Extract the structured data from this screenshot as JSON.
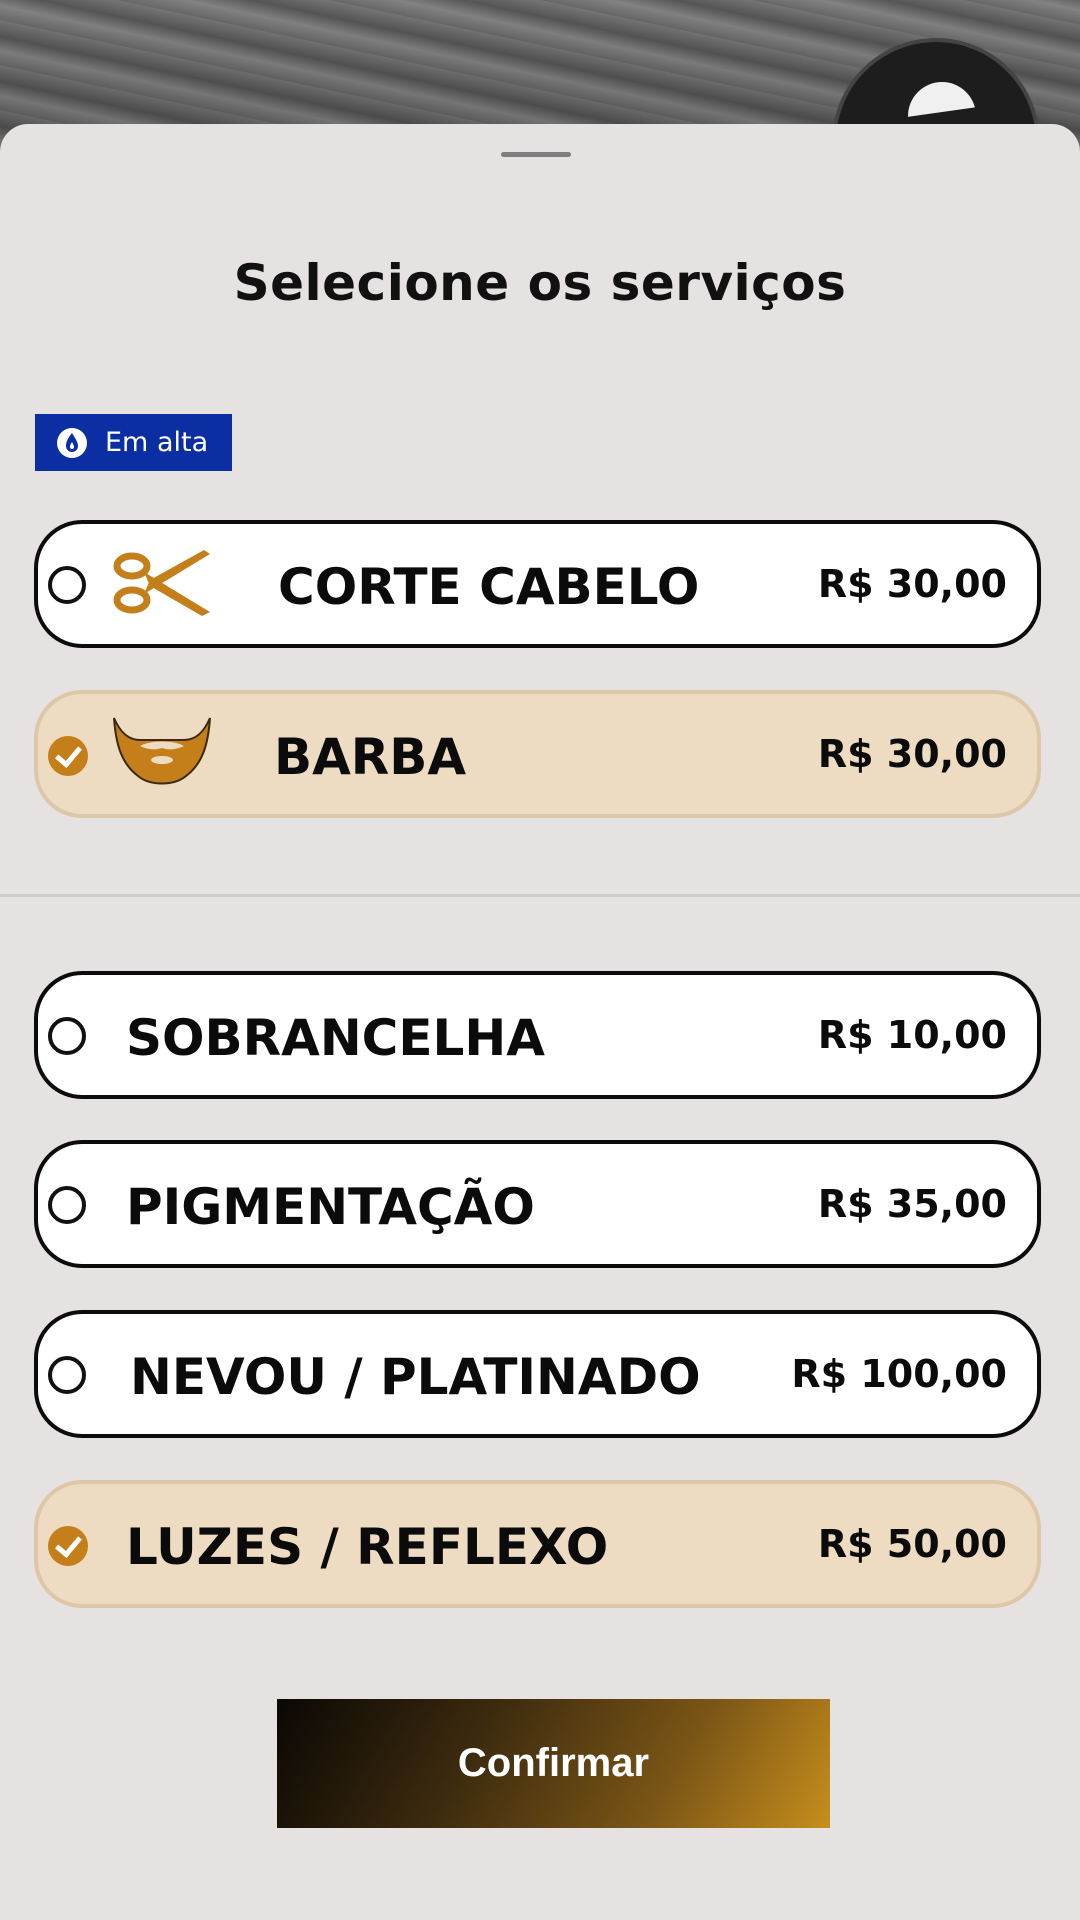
{
  "sheet": {
    "title": "Selecione os serviços",
    "badge": {
      "label": "Em alta",
      "icon": "flame-icon",
      "color": "#0b2ea3"
    }
  },
  "services": [
    {
      "name": "CORTE CABELO",
      "price": "R$ 30,00",
      "selected": false,
      "icon": "scissors-icon"
    },
    {
      "name": "BARBA",
      "price": "R$ 30,00",
      "selected": true,
      "icon": "beard-icon"
    },
    {
      "name": "SOBRANCELHA",
      "price": "R$ 10,00",
      "selected": false
    },
    {
      "name": "PIGMENTAÇÃO",
      "price": "R$ 35,00",
      "selected": false
    },
    {
      "name": "NEVOU / PLATINADO",
      "price": "R$ 100,00",
      "selected": false
    },
    {
      "name": "LUZES / REFLEXO",
      "price": "R$ 50,00",
      "selected": true
    }
  ],
  "actions": {
    "confirm_label": "Confirmar"
  },
  "colors": {
    "accent": "#c47e1a",
    "selected_bg": "#eddbc2",
    "sheet_bg": "#e6e2e1"
  }
}
